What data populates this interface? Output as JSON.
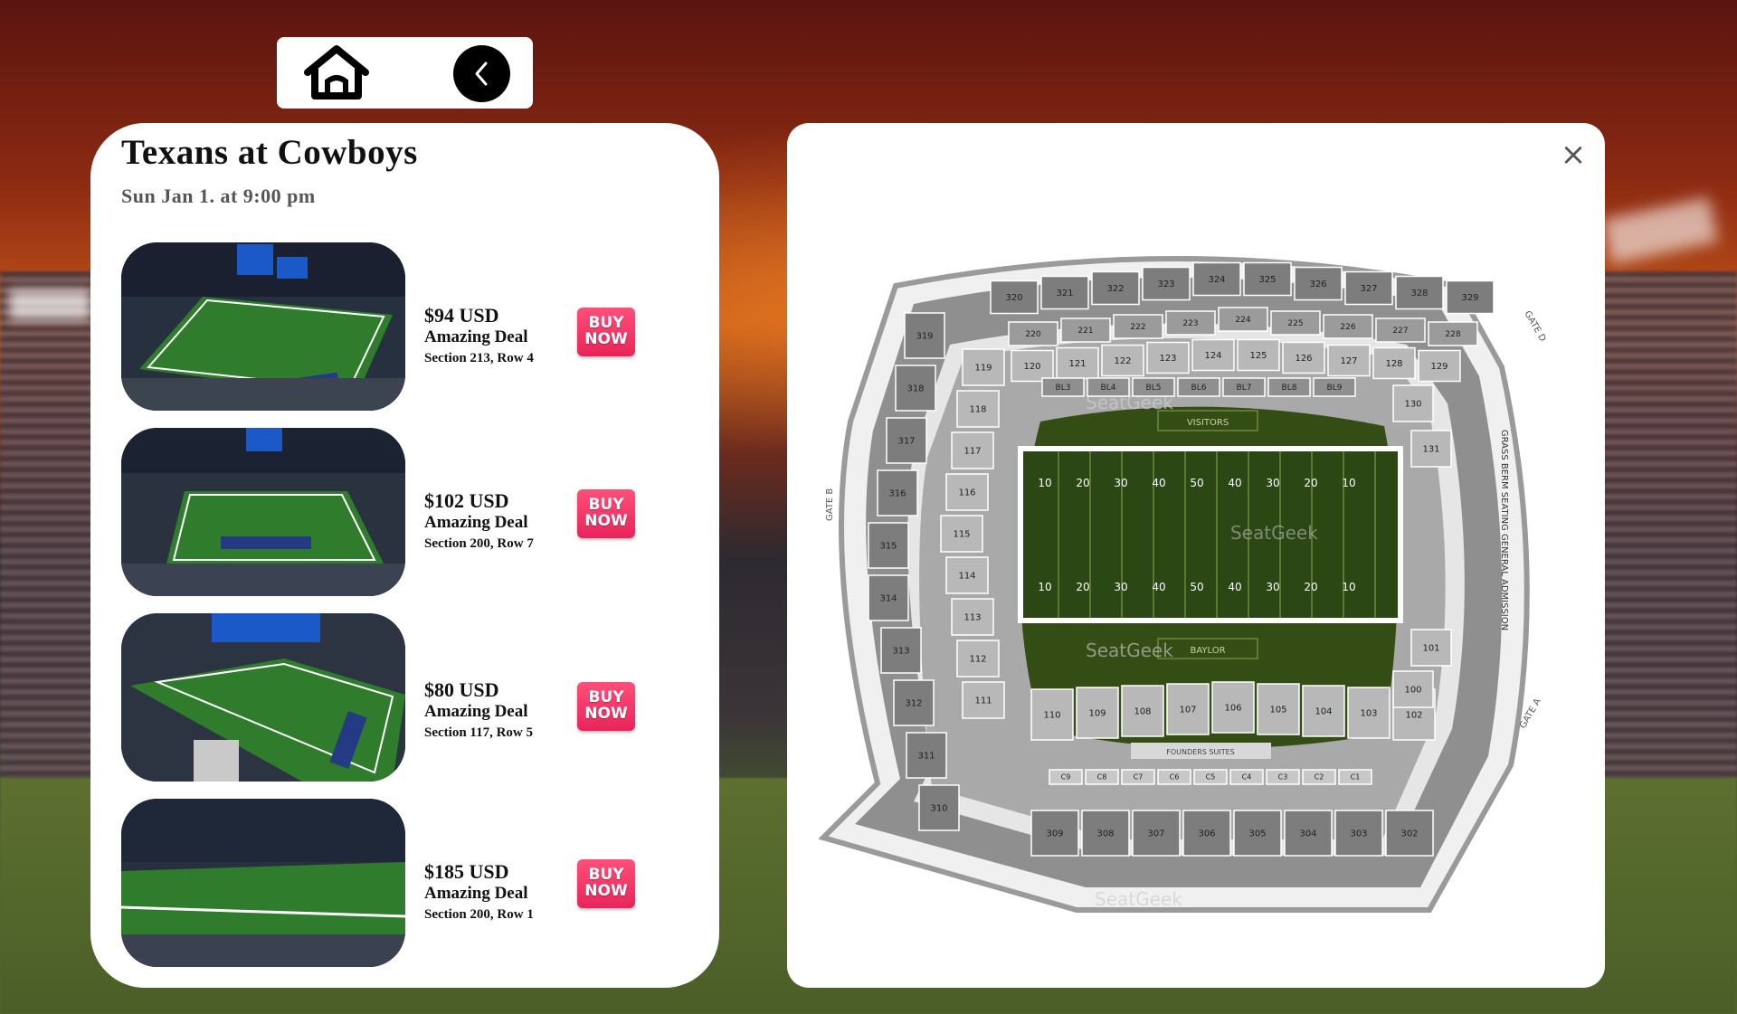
{
  "nav": {
    "home_icon": "home-icon",
    "back_icon": "chevron-left-icon"
  },
  "event": {
    "title": "Texans at Cowboys",
    "date": "Sun Jan 1. at 9:00 pm"
  },
  "tickets": [
    {
      "price": "$94 USD",
      "deal": "Amazing Deal",
      "section": "Section 213, Row 4",
      "buy_top": "BUY",
      "buy_bottom": "NOW"
    },
    {
      "price": "$102 USD",
      "deal": "Amazing Deal",
      "section": "Section 200, Row 7",
      "buy_top": "BUY",
      "buy_bottom": "NOW"
    },
    {
      "price": "$80 USD",
      "deal": "Amazing Deal",
      "section": "Section 117, Row 5",
      "buy_top": "BUY",
      "buy_bottom": "NOW"
    },
    {
      "price": "$185 USD",
      "deal": "Amazing Deal",
      "section": "Section 200, Row 1",
      "buy_top": "BUY",
      "buy_bottom": "NOW"
    }
  ],
  "map": {
    "close_label": "×",
    "visitors_label": "VISITORS",
    "home_label": "BAYLOR",
    "founders_label": "FOUNDERS SUITES",
    "berm_label": "GRASS BERM SEATING GENERAL ADMISSION",
    "gate_b": "GATE B",
    "gate_d": "GATE D",
    "gate_a": "GATE A",
    "watermark": "SeatGeek",
    "upper_top": [
      "320",
      "321",
      "322",
      "323",
      "324",
      "325",
      "326",
      "327",
      "328",
      "329"
    ],
    "mid_top": [
      "220",
      "221",
      "222",
      "223",
      "224",
      "225",
      "226",
      "227",
      "228"
    ],
    "lower_top": [
      "120",
      "121",
      "122",
      "123",
      "124",
      "125",
      "126",
      "127",
      "128",
      "129"
    ],
    "box_top": [
      "BL3",
      "BL4",
      "BL5",
      "BL6",
      "BL7",
      "BL8",
      "BL9"
    ],
    "lower_bottom": [
      "110",
      "109",
      "108",
      "107",
      "106",
      "105",
      "104",
      "103",
      "102"
    ],
    "upper_bottom": [
      "309",
      "308",
      "307",
      "306",
      "305",
      "304",
      "303",
      "302"
    ],
    "club_bottom": [
      "C9",
      "C8",
      "C7",
      "C6",
      "C5",
      "C4",
      "C3",
      "C2",
      "C1"
    ],
    "left_lower": [
      "119",
      "118",
      "117",
      "116",
      "115",
      "114",
      "113",
      "112",
      "111"
    ],
    "left_upper": [
      "319",
      "318",
      "317",
      "316",
      "315",
      "314",
      "313",
      "312",
      "311",
      "310"
    ],
    "right_side": [
      "130",
      "131",
      "101",
      "100"
    ],
    "yard_labels": [
      "10",
      "20",
      "30",
      "40",
      "50",
      "40",
      "30",
      "20",
      "10"
    ]
  }
}
